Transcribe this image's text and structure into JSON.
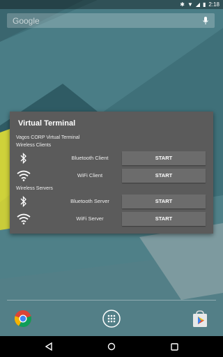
{
  "status_bar": {
    "time": "2:18"
  },
  "search": {
    "placeholder": "Google"
  },
  "dialog": {
    "title": "Virtual Terminal",
    "app_name": "Vagos CORP Virtual Terminal",
    "clients_header": "Wireless Clients",
    "servers_header": "Wireless Servers",
    "rows": [
      {
        "icon": "bluetooth-icon",
        "label": "Bluetooth Client",
        "button": "START"
      },
      {
        "icon": "wifi-icon",
        "label": "WiFi Client",
        "button": "START"
      },
      {
        "icon": "bluetooth-icon",
        "label": "Bluetooth Server",
        "button": "START"
      },
      {
        "icon": "wifi-icon",
        "label": "WiFi Server",
        "button": "START"
      }
    ]
  },
  "dock": {
    "apps": [
      {
        "name": "chrome-icon"
      },
      {
        "name": "app-drawer-icon"
      },
      {
        "name": "play-store-icon"
      }
    ]
  },
  "nav": {
    "buttons": [
      {
        "name": "back-icon"
      },
      {
        "name": "home-icon"
      },
      {
        "name": "recents-icon"
      }
    ]
  }
}
